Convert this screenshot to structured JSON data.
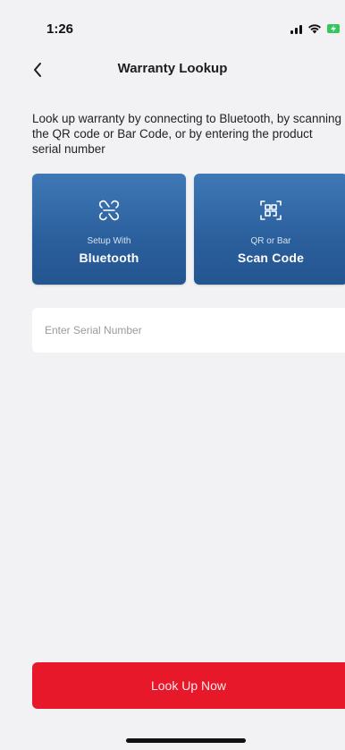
{
  "status_bar": {
    "time": "1:26",
    "icons": [
      "signal-icon",
      "wifi-icon",
      "battery-charging-icon"
    ],
    "battery_color": "#35c759"
  },
  "header": {
    "back_icon": "chevron-left-icon",
    "title": "Warranty Lookup"
  },
  "description": "Look up warranty by connecting to Bluetooth, by scanning the QR code or Bar Code, or by entering the product serial number",
  "tiles": [
    {
      "icon": "bluetooth-pairing-icon",
      "subtitle": "Setup With",
      "label": "Bluetooth"
    },
    {
      "icon": "scan-code-icon",
      "subtitle": "QR or Bar",
      "label": "Scan Code"
    }
  ],
  "serial_input": {
    "placeholder": "Enter Serial Number",
    "value": ""
  },
  "primary_button": {
    "label": "Look Up Now",
    "color": "#e8182b"
  },
  "colors": {
    "tile_blue": "#2f67a6",
    "background": "#f2f2f4"
  }
}
